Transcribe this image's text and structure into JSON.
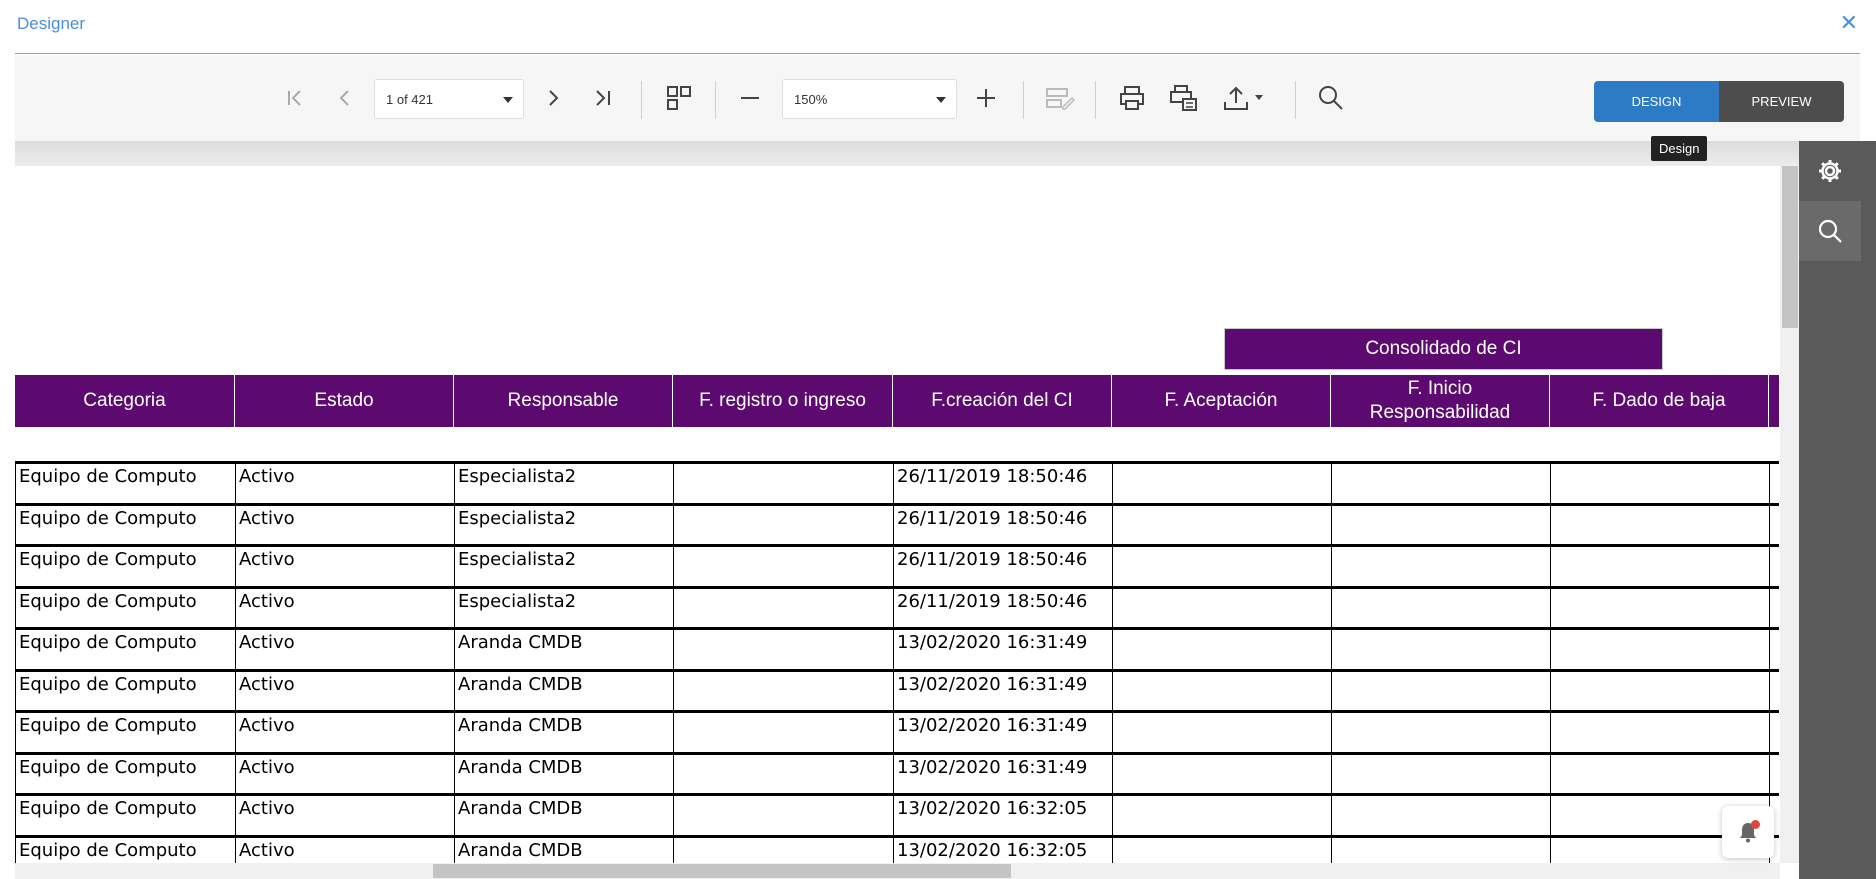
{
  "window": {
    "title": "Designer",
    "close_icon": "close-icon"
  },
  "toolbar": {
    "page_indicator": "1 of 421",
    "zoom_value": "150%",
    "icons": [
      "first-page-icon",
      "prev-page-icon",
      "next-page-icon",
      "last-page-icon",
      "multipage-icon",
      "zoom-out-icon",
      "zoom-in-icon",
      "edit-fields-icon",
      "print-icon",
      "print-page-icon",
      "export-icon",
      "search-icon"
    ],
    "design_label": "DESIGN",
    "preview_label": "PREVIEW",
    "tooltip": "Design"
  },
  "report": {
    "group_header": "Consolidado de CI",
    "columns": [
      "Categoria",
      "Estado",
      "Responsable",
      "F. registro o ingreso",
      "F.creación del CI",
      "F. Aceptación",
      "F. Inicio Responsabilidad",
      "F. Dado de baja"
    ],
    "rows": [
      [
        "Equipo de Computo",
        "Activo",
        "Especialista2",
        "",
        "26/11/2019 18:50:46",
        "",
        "",
        ""
      ],
      [
        "Equipo de Computo",
        "Activo",
        "Especialista2",
        "",
        "26/11/2019 18:50:46",
        "",
        "",
        ""
      ],
      [
        "Equipo de Computo",
        "Activo",
        "Especialista2",
        "",
        "26/11/2019 18:50:46",
        "",
        "",
        ""
      ],
      [
        "Equipo de Computo",
        "Activo",
        "Especialista2",
        "",
        "26/11/2019 18:50:46",
        "",
        "",
        ""
      ],
      [
        "Equipo de Computo",
        "Activo",
        "Aranda CMDB",
        "",
        "13/02/2020 16:31:49",
        "",
        "",
        ""
      ],
      [
        "Equipo de Computo",
        "Activo",
        "Aranda CMDB",
        "",
        "13/02/2020 16:31:49",
        "",
        "",
        ""
      ],
      [
        "Equipo de Computo",
        "Activo",
        "Aranda CMDB",
        "",
        "13/02/2020 16:31:49",
        "",
        "",
        ""
      ],
      [
        "Equipo de Computo",
        "Activo",
        "Aranda CMDB",
        "",
        "13/02/2020 16:31:49",
        "",
        "",
        ""
      ],
      [
        "Equipo de Computo",
        "Activo",
        "Aranda CMDB",
        "",
        "13/02/2020 16:32:05",
        "",
        "",
        ""
      ],
      [
        "Equipo de Computo",
        "Activo",
        "Aranda CMDB",
        "",
        "13/02/2020 16:32:05",
        "",
        "",
        ""
      ]
    ]
  },
  "sidepanel": {
    "items": [
      "gear-icon",
      "search-icon"
    ]
  },
  "notifications": {
    "icon": "bell-icon",
    "has_unread": true
  },
  "colors": {
    "accent": "#2d7bc4",
    "header_purple": "#5c0a6f",
    "title_blue": "#4a8fd9",
    "side_panel": "#5a5a5a"
  }
}
